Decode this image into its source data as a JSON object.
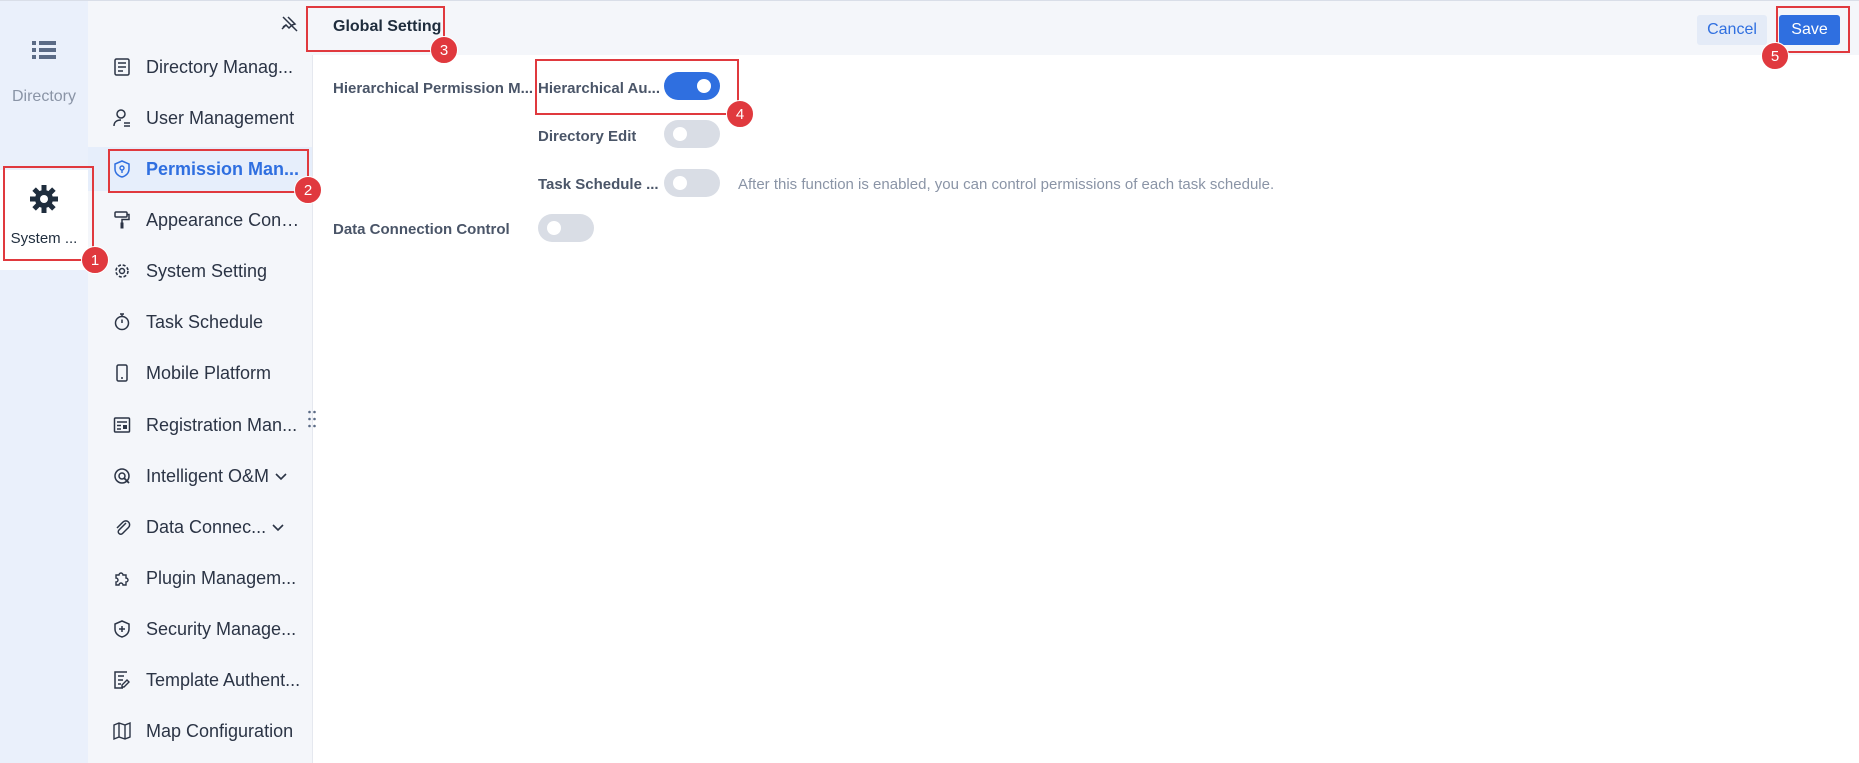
{
  "rail": {
    "items": [
      {
        "label": "Directory",
        "icon": "list-icon"
      },
      {
        "label": "System ...",
        "icon": "gear-icon"
      }
    ]
  },
  "sidebar": {
    "items": [
      {
        "label": "Directory Manag...",
        "icon": "document-list-icon"
      },
      {
        "label": "User Management",
        "icon": "user-icon"
      },
      {
        "label": "Permission Man...",
        "icon": "shield-icon"
      },
      {
        "label": "Appearance Conf...",
        "icon": "paint-roller-icon"
      },
      {
        "label": "System Setting",
        "icon": "gear-icon"
      },
      {
        "label": "Task Schedule",
        "icon": "stopwatch-icon"
      },
      {
        "label": "Mobile Platform",
        "icon": "mobile-icon"
      },
      {
        "label": "Registration Man...",
        "icon": "registration-icon"
      },
      {
        "label": "Intelligent O&M",
        "icon": "maintenance-icon"
      },
      {
        "label": "Data Connec...",
        "icon": "paperclip-icon"
      },
      {
        "label": "Plugin Managem...",
        "icon": "puzzle-icon"
      },
      {
        "label": "Security Manage...",
        "icon": "security-shield-icon"
      },
      {
        "label": "Template Authent...",
        "icon": "template-icon"
      },
      {
        "label": "Map Configuration",
        "icon": "map-icon"
      }
    ]
  },
  "header": {
    "title": "Global Setting",
    "cancel_label": "Cancel",
    "save_label": "Save"
  },
  "settings": {
    "hierarchical_permission_label": "Hierarchical Permission M...",
    "hierarchical_auth_label": "Hierarchical Au...",
    "hierarchical_auth_on": true,
    "directory_edit_label": "Directory Edit",
    "directory_edit_on": false,
    "task_schedule_label": "Task Schedule ...",
    "task_schedule_on": false,
    "task_schedule_hint": "After this function is enabled, you can control permissions of each task schedule.",
    "data_connection_label": "Data Connection Control",
    "data_connection_on": false
  },
  "annotations": [
    "1",
    "2",
    "3",
    "4",
    "5"
  ],
  "colors": {
    "accent": "#2f6fe0",
    "annotation": "#e0393e"
  }
}
